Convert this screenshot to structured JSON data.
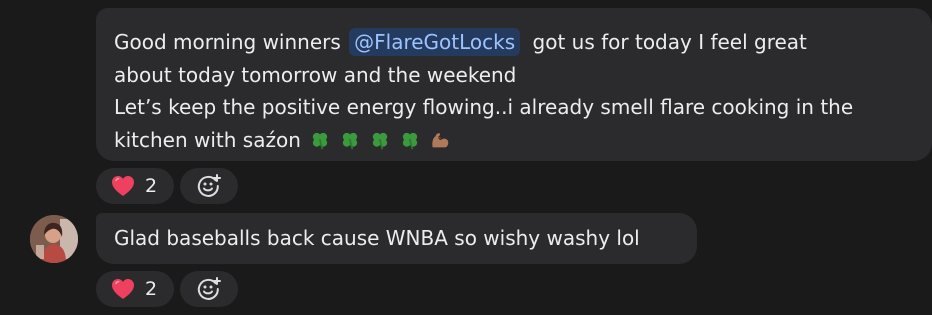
{
  "messages": [
    {
      "line1_before": "Good morning winners",
      "mention": "@FlareGotLocks",
      "line1_after": "got us for today I feel great",
      "line2": "about today tomorrow and the weekend",
      "line3": "Let’s keep the positive energy flowing..i already smell flare cooking in the",
      "line4": "kitchen with saźon",
      "emojis": [
        "four-leaf-clover",
        "four-leaf-clover",
        "four-leaf-clover",
        "four-leaf-clover",
        "flexed-biceps"
      ],
      "reactions": {
        "heart_count": "2"
      }
    },
    {
      "text": "Glad baseballs back cause WNBA so wishy washy lol",
      "reactions": {
        "heart_count": "2"
      }
    }
  ],
  "colors": {
    "background": "#1a1a1b",
    "bubble": "#2b2b2d",
    "mention_bg": "#243a5e",
    "mention_text": "#9cc3ff",
    "heart": "#f0405f"
  },
  "icons": {
    "reaction": "heart-icon",
    "add_reaction": "add-reaction-icon"
  }
}
